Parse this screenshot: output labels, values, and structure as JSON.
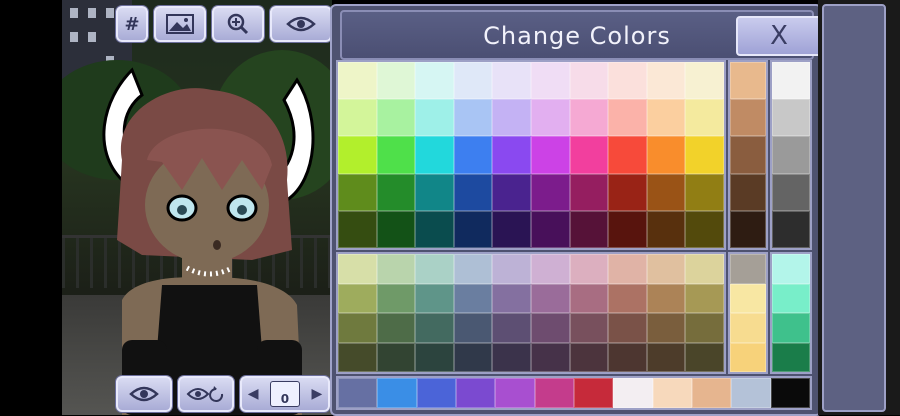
{
  "title": "Change Colors",
  "close_label": "X",
  "counter_value": "0",
  "toolbar_top": {
    "grid_label": "#"
  },
  "colors": {
    "accent": "#4e5270",
    "border": "#9fa2c8"
  },
  "main_grid": [
    [
      "#eef5c8",
      "#dff7d6",
      "#d6f6f3",
      "#dfe8f8",
      "#e8e2f8",
      "#f0ddf5",
      "#f7dce9",
      "#fbe0dc",
      "#fbe8d6",
      "#f7f1d2"
    ],
    [
      "#d3f59a",
      "#a8f2a0",
      "#9ef0e8",
      "#a9c5f4",
      "#c4b2f4",
      "#e2aff0",
      "#f5a9d3",
      "#fbb2a9",
      "#fbcf9f",
      "#f4ea9e"
    ],
    [
      "#b2ef2c",
      "#4fe04a",
      "#22d8dc",
      "#3d7ff0",
      "#8a49f0",
      "#cc42e6",
      "#f23f9e",
      "#f74a3a",
      "#f98d2c",
      "#f2d22a"
    ],
    [
      "#5f8c1c",
      "#248c2a",
      "#118688",
      "#1d4aa0",
      "#4a238f",
      "#7c1c8c",
      "#951e60",
      "#992316",
      "#9a5316",
      "#917e14"
    ],
    [
      "#354d11",
      "#135217",
      "#0a4c4e",
      "#102a5e",
      "#2a1454",
      "#48105a",
      "#561238",
      "#58140d",
      "#58300d",
      "#534a0c"
    ]
  ],
  "main_side1": [
    "#e8b98d",
    "#c08b64",
    "#8a5d3f",
    "#5a3b25",
    "#2e1c12"
  ],
  "main_side2": [
    "#f2f2f2",
    "#c8c8c8",
    "#9a9a9a",
    "#646464",
    "#2d2d2d"
  ],
  "muted_grid": [
    [
      "#d7dfa8",
      "#b9d4ac",
      "#aad1c6",
      "#aebfd5",
      "#bdb2d6",
      "#cfb0d3",
      "#dcafbf",
      "#e0b3a6",
      "#e0c09f",
      "#dcd39c"
    ],
    [
      "#9eac5d",
      "#6f9a68",
      "#5f9589",
      "#6a7ea0",
      "#8470a0",
      "#9a6c9a",
      "#a86d82",
      "#ac7264",
      "#ac8357",
      "#a69955"
    ],
    [
      "#6f7a3e",
      "#4e6c48",
      "#436a60",
      "#4a5872",
      "#5d4f73",
      "#6e4c6f",
      "#78505d",
      "#7a5248",
      "#7a5e3d",
      "#766d3c"
    ],
    [
      "#454b2a",
      "#324432",
      "#2c443e",
      "#30394a",
      "#3b334b",
      "#463249",
      "#4c343d",
      "#4d3630",
      "#4d3c2a",
      "#4a4529"
    ]
  ],
  "muted_side1": [
    "#a59f97",
    "#f8e7a3",
    "#f7dc90",
    "#f7d27a"
  ],
  "muted_side2": [
    "#b3f5ea",
    "#78eec9",
    "#3fc18c",
    "#1a7d4a"
  ],
  "bottom_row": [
    "#6670a3",
    "#3a8ee6",
    "#4b64d8",
    "#7b4ad0",
    "#a84fd0",
    "#c43c8c",
    "#c62a3a",
    "#f3eef2",
    "#f7d9bc",
    "#e6b58f",
    "#b4c2d8",
    "#0a0a0a"
  ]
}
